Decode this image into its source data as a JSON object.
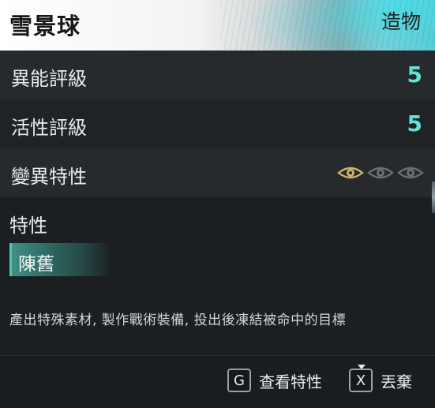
{
  "item": {
    "name": "雪景球",
    "category": "造物"
  },
  "stats": [
    {
      "label": "異能評級",
      "value": "5"
    },
    {
      "label": "活性評級",
      "value": "5"
    },
    {
      "label": "變異特性",
      "eyes": {
        "active": 1,
        "total": 3,
        "icon": "eye-icon"
      }
    }
  ],
  "traits": {
    "heading": "特性",
    "items": [
      "陳舊"
    ]
  },
  "description": "產出特殊素材, 製作戰術裝備, 投出後凍結被命中的目標",
  "actions": [
    {
      "key": "G",
      "label": "查看特性"
    },
    {
      "key": "X",
      "label": "丟棄"
    }
  ],
  "colors": {
    "accent": "#5fe3d6",
    "eye_active": "#c9b46a",
    "eye_inactive": "#6a6f72",
    "trait_chip": "#3f8f86"
  }
}
